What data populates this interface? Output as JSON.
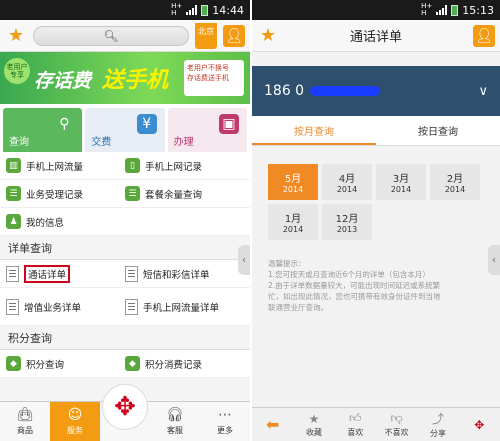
{
  "left": {
    "status": {
      "time": "14:44",
      "net_top": "H+",
      "net_bottom": "H"
    },
    "topbar": {
      "region": "北京"
    },
    "banner": {
      "tag": "老用户专享",
      "line1": "存话费",
      "line2": "送手机",
      "box_line1": "老用户不换号",
      "box_line2": "存话费送手机"
    },
    "categories": [
      {
        "label": "查询"
      },
      {
        "label": "交费"
      },
      {
        "label": "办理"
      }
    ],
    "menu_rows": [
      [
        "手机上网流量",
        "手机上网记录"
      ],
      [
        "业务受理记录",
        "套餐余量查询"
      ]
    ],
    "my_info": "我的信息",
    "section_detail": "详单查询",
    "detail_rows": [
      [
        "通话详单",
        "短信和彩信详单"
      ],
      [
        "增值业务详单",
        "手机上网流量详单"
      ]
    ],
    "section_points": "积分查询",
    "points_row": [
      "积分查询",
      "积分消费记录"
    ],
    "bottom_nav": [
      {
        "label": "商品"
      },
      {
        "label": "服务"
      },
      {
        "label": ""
      },
      {
        "label": "客服"
      },
      {
        "label": "更多"
      }
    ]
  },
  "right": {
    "status": {
      "time": "15:13",
      "net_top": "H+",
      "net_bottom": "H"
    },
    "title": "通话详单",
    "phone_prefix": "186 0",
    "tabs": [
      "按月查询",
      "按日查询"
    ],
    "months": [
      {
        "m": "5月",
        "y": "2014"
      },
      {
        "m": "4月",
        "y": "2014"
      },
      {
        "m": "3月",
        "y": "2014"
      },
      {
        "m": "2月",
        "y": "2014"
      },
      {
        "m": "1月",
        "y": "2014"
      },
      {
        "m": "12月",
        "y": "2013"
      }
    ],
    "hint_title": "温馨提示：",
    "hint_lines": [
      "1.您可按天或月查询近6个月的详单（包含本月）",
      "2.由于详单数据量较大，可能出现时间延迟或系统繁",
      "忙，如出现此情况，您也可携带有效身份证件到当地",
      "联通营业厅查询。"
    ],
    "bottom": [
      {
        "label": ""
      },
      {
        "label": "收藏"
      },
      {
        "label": "喜欢"
      },
      {
        "label": "不喜欢"
      },
      {
        "label": "分享"
      },
      {
        "label": ""
      }
    ]
  }
}
